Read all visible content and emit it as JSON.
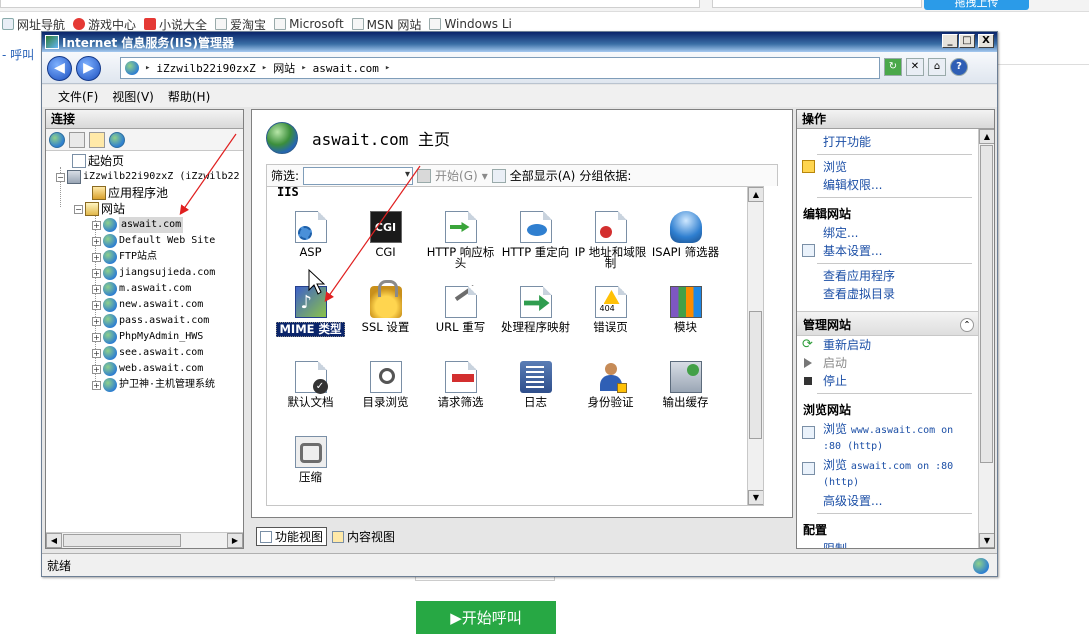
{
  "browser": {
    "upload_label": "拖拽上传",
    "bookmarks": [
      "网址导航",
      "游戏中心",
      "小说大全",
      "爱淘宝",
      "Microsoft",
      "MSN 网站",
      "Windows Li"
    ],
    "left_text": "- 呼叫",
    "start_call_label": "▶开始呼叫"
  },
  "window": {
    "title": "Internet 信息服务(IIS)管理器",
    "buttons": {
      "minimize": "_",
      "maximize": "□",
      "close": "X"
    }
  },
  "nav": {
    "back": "◀",
    "forward": "▶",
    "breadcrumb": [
      "iZzwilb22i90zxZ",
      "网站",
      "aswait.com"
    ],
    "tools": {
      "help": "?"
    }
  },
  "menu": [
    "文件(F)",
    "视图(V)",
    "帮助(H)"
  ],
  "connections": {
    "title": "连接",
    "tree": [
      {
        "label": "起始页",
        "level": 0
      },
      {
        "label": "iZzwilb22i90zxZ (iZzwilb22",
        "level": 0,
        "expander": "⊟"
      },
      {
        "label": "应用程序池",
        "level": 1
      },
      {
        "label": "网站",
        "level": 1,
        "expander": "⊟"
      }
    ],
    "sites": [
      "aswait.com",
      "Default Web Site",
      "FTP站点",
      "jiangsujieda.com",
      "m.aswait.com",
      "new.aswait.com",
      "pass.aswait.com",
      "PhpMyAdmin_HWS",
      "see.aswait.com",
      "web.aswait.com",
      "护卫神·主机管理系统"
    ],
    "selected_site": "aswait.com"
  },
  "home": {
    "title": "aswait.com 主页",
    "filter_label": "筛选:",
    "start_label": "开始(G)",
    "show_all_label": "全部显示(A)",
    "group_by_label": "分组依据:",
    "group_name": "IIS",
    "features": [
      {
        "label": "ASP",
        "icon": "asp-icon"
      },
      {
        "label": "CGI",
        "icon": "cgi-icon"
      },
      {
        "label": "HTTP 响应标头",
        "icon": "http-headers-icon"
      },
      {
        "label": "HTTP 重定向",
        "icon": "http-redirect-icon"
      },
      {
        "label": "IP 地址和域限制",
        "icon": "ip-restrictions-icon"
      },
      {
        "label": "ISAPI 筛选器",
        "icon": "isapi-filters-icon"
      },
      {
        "label": "MIME 类型",
        "icon": "mime-types-icon",
        "selected": true
      },
      {
        "label": "SSL 设置",
        "icon": "ssl-icon"
      },
      {
        "label": "URL 重写",
        "icon": "url-rewrite-icon"
      },
      {
        "label": "处理程序映射",
        "icon": "handler-mappings-icon"
      },
      {
        "label": "错误页",
        "icon": "error-pages-icon"
      },
      {
        "label": "模块",
        "icon": "modules-icon"
      },
      {
        "label": "默认文档",
        "icon": "default-document-icon"
      },
      {
        "label": "目录浏览",
        "icon": "directory-browsing-icon"
      },
      {
        "label": "请求筛选",
        "icon": "request-filtering-icon"
      },
      {
        "label": "日志",
        "icon": "logging-icon"
      },
      {
        "label": "身份验证",
        "icon": "authentication-icon"
      },
      {
        "label": "输出缓存",
        "icon": "output-caching-icon"
      },
      {
        "label": "压缩",
        "icon": "compression-icon"
      }
    ],
    "cgi_text": "CGI",
    "error_num": "404"
  },
  "view_tabs": {
    "features": "功能视图",
    "content": "内容视图"
  },
  "actions": {
    "title": "操作",
    "open_feature": "打开功能",
    "explore": "浏览",
    "edit_permissions": "编辑权限...",
    "edit_site_title": "编辑网站",
    "bindings": "绑定...",
    "basic_settings": "基本设置...",
    "view_apps": "查看应用程序",
    "view_vdirs": "查看虚拟目录",
    "manage_site_title": "管理网站",
    "restart": "重新启动",
    "start": "启动",
    "stop": "停止",
    "browse_site_title": "浏览网站",
    "browse_www_pre": "浏览",
    "browse_www": "www.aswait.com on",
    "browse_www_2": ":80 (http)",
    "browse_root_pre": "浏览",
    "browse_root": "aswait.com on :80",
    "browse_root_2": "(http)",
    "advanced": "高级设置...",
    "config_title": "配置",
    "limits": "限制..."
  },
  "status": {
    "text": "就绪"
  }
}
